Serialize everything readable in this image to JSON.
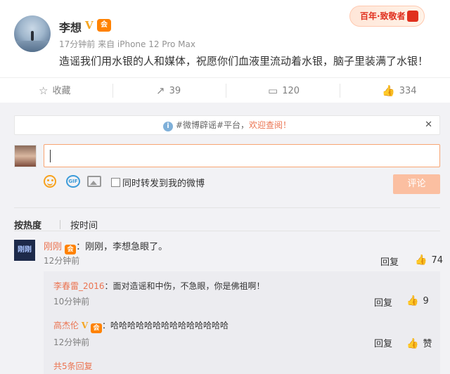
{
  "post": {
    "username": "李想",
    "verified_mark": "V",
    "vip_badge": "会",
    "meta": "17分钟前 来自 iPhone 12 Pro Max",
    "content": "造谣我们用水银的人和媒体，祝愿你们血液里流动着水银，脑子里装满了水银！",
    "top_badge": "百年·致敬者"
  },
  "actions": {
    "favorite_icon": "☆",
    "favorite_label": "收藏",
    "repost_icon": "↗",
    "repost_count": "39",
    "comment_icon": "▭",
    "comment_count": "120",
    "like_icon": "👍",
    "like_count": "334"
  },
  "comments": {
    "notice_icon": "i",
    "notice_text": "#微博辟谣#平台，",
    "notice_link": "欢迎查阅！",
    "notice_close": "✕",
    "submit_label": "评论",
    "gif_label": "GIF",
    "repost_check_label": "同时转发到我的微博",
    "sort_hot": "按热度",
    "sort_time": "按时间",
    "reply_label": "回复",
    "like_label": "赞",
    "list": [
      {
        "avatar_text": "刚刚",
        "name": "刚刚",
        "text": "：刚刚，李想急眼了。",
        "time": "12分钟前",
        "likes": "74"
      }
    ],
    "replies": [
      {
        "name": "李春雷_2016",
        "text": "：面对造谣和中伤，不急眼，你是佛祖啊！",
        "time": "10分钟前",
        "likes": "9"
      },
      {
        "name": "高杰伦",
        "text": "：哈哈哈哈哈哈哈哈哈哈哈哈哈哈",
        "time": "12分钟前",
        "likes": "赞"
      }
    ],
    "more_replies": "共5条回复"
  }
}
